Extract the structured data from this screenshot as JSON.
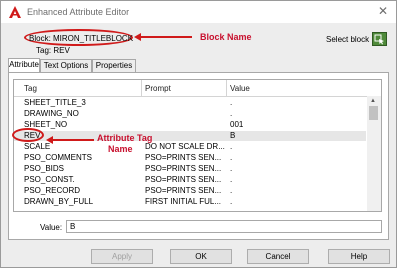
{
  "window": {
    "title": "Enhanced Attribute Editor",
    "close_glyph": "✕"
  },
  "header": {
    "block_line": "Block: MIRON_TITLEBLOCK",
    "tag_line": "Tag: REV",
    "select_block_label": "Select block"
  },
  "tabs": [
    {
      "label": "Attribute",
      "active": true
    },
    {
      "label": "Text Options",
      "active": false
    },
    {
      "label": "Properties",
      "active": false
    }
  ],
  "grid": {
    "columns": [
      "Tag",
      "Prompt",
      "Value"
    ],
    "rows": [
      {
        "tag": "SHEET_TITLE_3",
        "prompt": "",
        "value": "."
      },
      {
        "tag": "DRAWING_NO",
        "prompt": "",
        "value": "."
      },
      {
        "tag": "SHEET_NO",
        "prompt": "",
        "value": "001"
      },
      {
        "tag": "REV",
        "prompt": "",
        "value": "B"
      },
      {
        "tag": "SCALE",
        "prompt": "DO NOT SCALE DR...",
        "value": "."
      },
      {
        "tag": "PSO_COMMENTS",
        "prompt": "PSO=PRINTS SEN...",
        "value": "."
      },
      {
        "tag": "PSO_BIDS",
        "prompt": "PSO=PRINTS SEN...",
        "value": "."
      },
      {
        "tag": "PSO_CONST.",
        "prompt": "PSO=PRINTS SEN...",
        "value": "."
      },
      {
        "tag": "PSO_RECORD",
        "prompt": "PSO=PRINTS SEN...",
        "value": "."
      },
      {
        "tag": "DRAWN_BY_FULL",
        "prompt": "FIRST INITIAL FUL...",
        "value": "."
      }
    ],
    "selected_row": 3
  },
  "value_field": {
    "label": "Value:",
    "value": "B"
  },
  "buttons": {
    "apply": "Apply",
    "ok": "OK",
    "cancel": "Cancel",
    "help": "Help"
  },
  "annotations": {
    "block_name": "Block Name",
    "attribute_tag_line1": "Attribute Tag",
    "attribute_tag_line2": "Name",
    "color": "#c8102e"
  },
  "icons": {
    "app": "autocad-logo-icon",
    "select_block": "select-block-icon",
    "close": "close-icon"
  }
}
